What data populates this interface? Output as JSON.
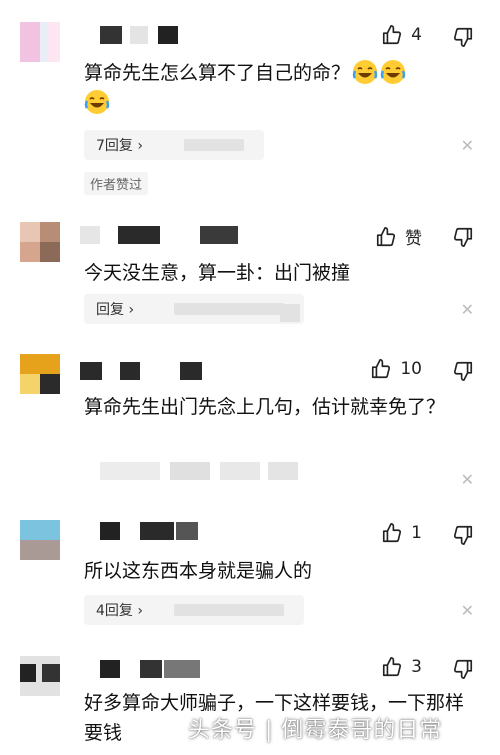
{
  "comments": [
    {
      "likes": "4",
      "text": "算命先生怎么算不了自己的命？",
      "reply_label": "7回复 ›",
      "extra_badge": "作者赞过"
    },
    {
      "likes": "赞",
      "text": "今天没生意，算一卦：出门被撞",
      "reply_label": "回复 ›"
    },
    {
      "likes": "10",
      "text": "算命先生出门先念上几句，估计就幸免了？"
    },
    {
      "likes": "1",
      "text": "所以这东西本身就是骗人的",
      "reply_label": "4回复 ›"
    },
    {
      "likes": "3",
      "text": "好多算命大师骗子，一下这样要钱，一下那样要钱"
    }
  ],
  "watermark": "头条号 | 倒霉泰哥的日常",
  "icons": {
    "like": "thumb-up-icon",
    "dislike": "thumb-down-icon",
    "close": "close-icon",
    "emoji": "laughing-crying-emoji-icon"
  }
}
